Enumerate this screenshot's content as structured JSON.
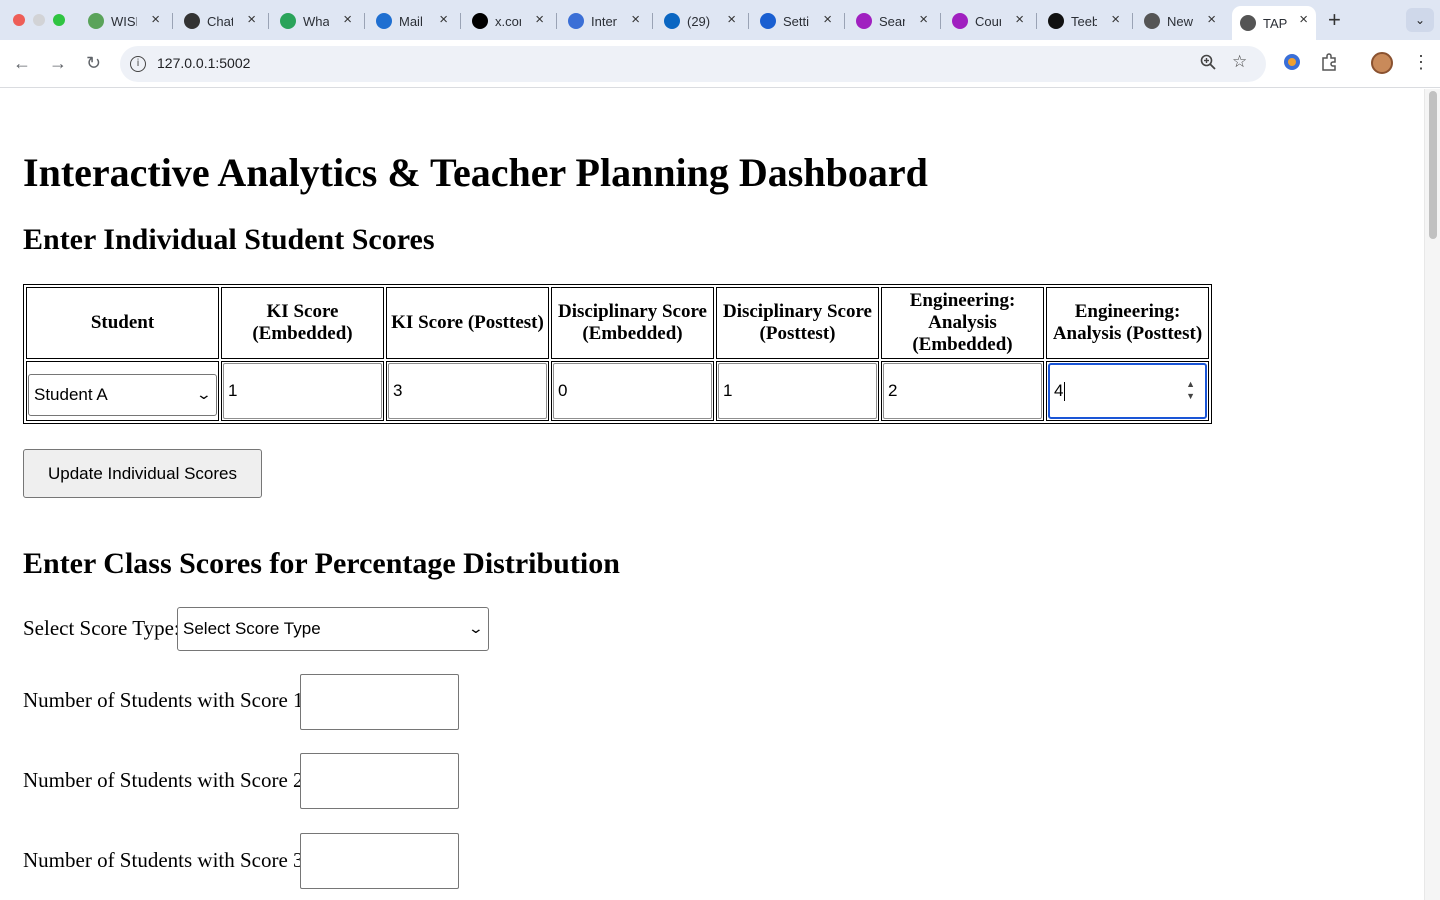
{
  "browser": {
    "tabs": [
      {
        "title": "WISE",
        "icon": "globe-icon",
        "color": "#5aa35a"
      },
      {
        "title": "ChatGPT",
        "icon": "openai-icon",
        "color": "#333333"
      },
      {
        "title": "WhatsApp",
        "icon": "whatsapp-icon",
        "color": "#2aa35a"
      },
      {
        "title": "Mail",
        "icon": "outlook-icon",
        "color": "#1f6fd1"
      },
      {
        "title": "x.com",
        "icon": "x-icon",
        "color": "#000000"
      },
      {
        "title": "Internet",
        "icon": "web-icon",
        "color": "#3b6fd6"
      },
      {
        "title": "(29)",
        "icon": "linkedin-icon",
        "color": "#0a66c2"
      },
      {
        "title": "Settings",
        "icon": "gear-icon",
        "color": "#1a5fd1"
      },
      {
        "title": "Search",
        "icon": "search-app-icon",
        "color": "#a020c0"
      },
      {
        "title": "Courses",
        "icon": "course-app-icon",
        "color": "#a020c0"
      },
      {
        "title": "Teeb",
        "icon": "github-icon",
        "color": "#111111"
      },
      {
        "title": "New",
        "icon": "chrome-icon",
        "color": "#555555"
      },
      {
        "title": "TAP",
        "icon": "globe-icon",
        "color": "#555555"
      }
    ],
    "url": "127.0.0.1:5002"
  },
  "page": {
    "title": "Interactive Analytics & Teacher Planning Dashboard",
    "individual_section": {
      "heading": "Enter Individual Student Scores",
      "columns": [
        "Student",
        "KI Score (Embedded)",
        "KI Score (Posttest)",
        "Disciplinary Score (Embedded)",
        "Disciplinary Score (Posttest)",
        "Engineering: Analysis (Embedded)",
        "Engineering: Analysis (Posttest)"
      ],
      "row": {
        "student": "Student A",
        "ki_embedded": "1",
        "ki_posttest": "3",
        "disc_embedded": "0",
        "disc_posttest": "1",
        "eng_embedded": "2",
        "eng_posttest": "4"
      },
      "update_label": "Update Individual Scores"
    },
    "class_section": {
      "heading": "Enter Class Scores for Percentage Distribution",
      "score_type_label": "Select Score Type:",
      "score_type_value": "Select Score Type",
      "count_labels": [
        "Number of Students with Score 1:",
        "Number of Students with Score 2:",
        "Number of Students with Score 3:"
      ]
    }
  }
}
